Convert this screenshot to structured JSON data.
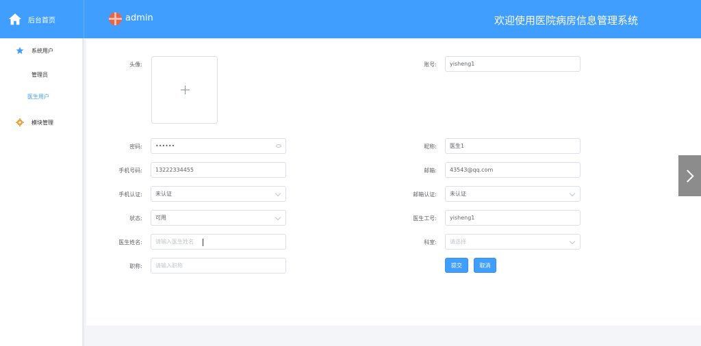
{
  "header": {
    "home_label": "后台首页",
    "username": "admin",
    "system_title": "欢迎使用医院病房信息管理系统"
  },
  "sidebar": {
    "items": [
      {
        "label": "系统用户",
        "icon": "star-icon"
      },
      {
        "label": "管理员"
      },
      {
        "label": "医生用户"
      },
      {
        "label": "模块管理",
        "icon": "gear-icon"
      }
    ]
  },
  "form": {
    "avatar_label": "头像:",
    "account_label": "账号:",
    "account_value": "yisheng1",
    "password_label": "密码:",
    "password_value": "••••••",
    "nickname_label": "昵称:",
    "nickname_value": "医生1",
    "phone_label": "手机号码:",
    "phone_value": "13222334455",
    "email_label": "邮箱:",
    "email_value": "43543@qq.com",
    "phone_verify_label": "手机认证:",
    "phone_verify_value": "未认证",
    "email_verify_label": "邮箱认证:",
    "email_verify_value": "未认证",
    "status_label": "状态:",
    "status_value": "可用",
    "doctor_no_label": "医生工号:",
    "doctor_no_value": "yisheng1",
    "doctor_name_label": "医生姓名:",
    "doctor_name_placeholder": "请输入医生姓名",
    "department_label": "科室:",
    "department_placeholder": "请选择",
    "title_label": "职称:",
    "title_placeholder": "请输入职称",
    "submit_label": "提交",
    "cancel_label": "取消"
  },
  "colors": {
    "primary": "#409eff",
    "sidebar_active": "#409eff"
  }
}
